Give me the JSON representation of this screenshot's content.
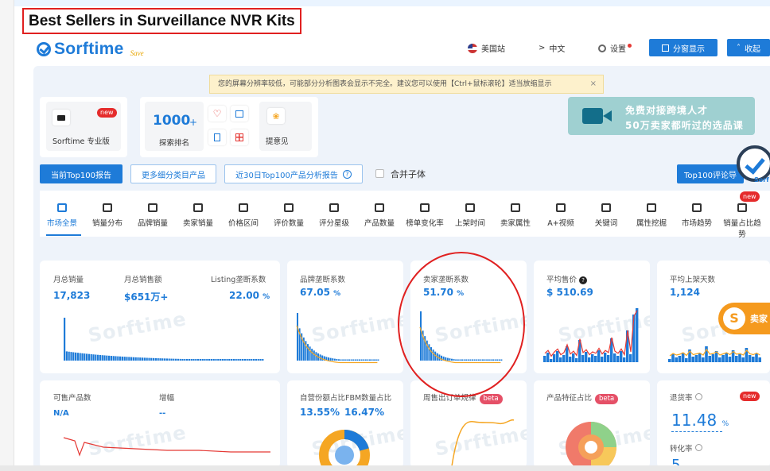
{
  "page_title": "Best Sellers in Surveillance NVR Kits",
  "logo": {
    "text": "Sorftime",
    "tagline": "Save"
  },
  "header": {
    "site": "美国站",
    "language": "中文",
    "language_prefix": ">",
    "settings": "设置",
    "split_view": "分窗显示",
    "collapse": "收起"
  },
  "notice": {
    "text": "您的屏幕分辨率较低，可能部分分析图表会显示不完全。建议您可以使用【Ctrl+鼠标滚轮】适当放缩显示",
    "close": "×"
  },
  "tools": {
    "pro_label": "Sorftime 专业版",
    "pro_badge": "new",
    "explore_value": "1000",
    "explore_plus": "+",
    "explore_label": "探索排名",
    "feedback_label": "提意见"
  },
  "banner": {
    "line1": "免费对接跨境人才",
    "line2": "50万卖家都听过的选品课"
  },
  "report_tabs": {
    "top100": "当前Top100报告",
    "subcategory": "更多细分类目产品",
    "last30": "近30日Top100产品分析报告",
    "last30_icon": "?",
    "merge_label": "合并子体",
    "review_report": "Top100评论导",
    "corner_sub": "Sorf"
  },
  "nav": {
    "new_badge": "new",
    "items": [
      {
        "label": "市场全景",
        "icon": "panorama-icon"
      },
      {
        "label": "销量分布",
        "icon": "bar-chart-icon"
      },
      {
        "label": "品牌销量",
        "icon": "brand-icon"
      },
      {
        "label": "卖家销量",
        "icon": "seller-icon"
      },
      {
        "label": "价格区间",
        "icon": "price-icon"
      },
      {
        "label": "评价数量",
        "icon": "review-icon"
      },
      {
        "label": "评分星级",
        "icon": "star-icon"
      },
      {
        "label": "产品数量",
        "icon": "trend-icon"
      },
      {
        "label": "榜单变化率",
        "icon": "smile-icon"
      },
      {
        "label": "上架时间",
        "icon": "calendar-icon"
      },
      {
        "label": "卖家属性",
        "icon": "wallet-icon"
      },
      {
        "label": "A+视频",
        "icon": "pie-icon"
      },
      {
        "label": "关键词",
        "icon": "keyword-icon"
      },
      {
        "label": "属性挖掘",
        "icon": "puzzle-icon"
      },
      {
        "label": "市场趋势",
        "icon": "trend-car-icon"
      },
      {
        "label": "销量占比趋势",
        "icon": "share-icon"
      }
    ]
  },
  "cards": {
    "total_sales": {
      "label": "月总销量",
      "value": "17,823"
    },
    "total_revenue": {
      "label": "月总销售额",
      "value": "$651万+"
    },
    "listing_monopoly": {
      "label": "Listing垄断系数",
      "value": "22.00",
      "unit": "%"
    },
    "brand_monopoly": {
      "label": "品牌垄断系数",
      "value": "67.05",
      "unit": "%"
    },
    "seller_monopoly": {
      "label": "卖家垄断系数",
      "value": "51.70",
      "unit": "%"
    },
    "avg_price": {
      "label": "平均售价",
      "value": "$ 510.69",
      "info": "?"
    },
    "avg_days": {
      "label": "平均上架天数",
      "value": "1,124"
    },
    "sellable": {
      "label": "可售产品数",
      "value": "N/A"
    },
    "growth": {
      "label": "增幅",
      "value": "--"
    },
    "self_fbm": {
      "label": "自营份额占比FBM数量占比",
      "value1": "13.55%",
      "value2": "16.47%"
    },
    "weekly": {
      "label": "周售出订单规律",
      "badge": "beta"
    },
    "feature": {
      "label": "产品特征占比",
      "badge": "beta"
    },
    "return": {
      "label": "退货率",
      "value": "11.48",
      "unit": "%",
      "conv_label": "转化率",
      "conv_value": "5",
      "badge": "new"
    }
  },
  "watermark": "Sorftime",
  "side_float": {
    "icon": "S",
    "text": "卖家"
  },
  "colors": {
    "accent": "#1e7bd8",
    "orange": "#f5a623",
    "red": "#e53935",
    "banner": "#9fd0d1"
  }
}
